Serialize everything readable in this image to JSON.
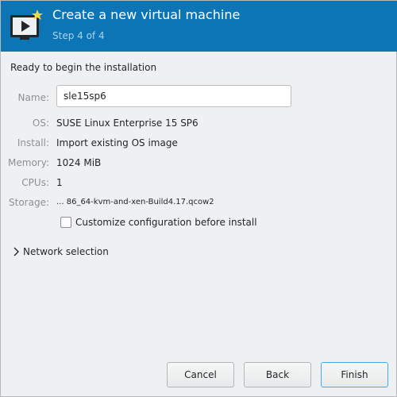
{
  "header": {
    "title": "Create a new virtual machine",
    "step": "Step 4 of 4",
    "background": "#0b75b5",
    "icon": "virtual-machine-icon"
  },
  "ready_text": "Ready to begin the installation",
  "name": {
    "label": "Name:",
    "value": "sle15sp6"
  },
  "details": [
    {
      "label": "OS:",
      "value": "SUSE Linux Enterprise 15 SP6"
    },
    {
      "label": "Install:",
      "value": "Import existing OS image"
    },
    {
      "label": "Memory:",
      "value": "1024 MiB"
    },
    {
      "label": "CPUs:",
      "value": "1"
    },
    {
      "label": "Storage:",
      "value": "... 86_64-kvm-and-xen-Build4.17.qcow2"
    }
  ],
  "customize": {
    "label": "Customize configuration before install",
    "checked": false
  },
  "network": {
    "label": "Network selection",
    "icon": "chevron-right-icon",
    "expanded": false
  },
  "buttons": {
    "cancel": "Cancel",
    "back": "Back",
    "finish": "Finish"
  },
  "colors": {
    "accent": "#3daee9",
    "label_gray": "#8d9094"
  }
}
